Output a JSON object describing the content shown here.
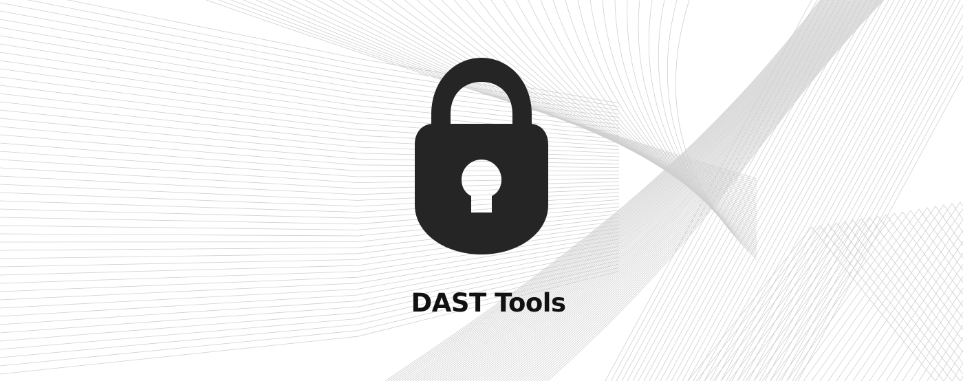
{
  "banner": {
    "title": "DAST Tools",
    "icon": "padlock-icon",
    "icon_color": "#252525",
    "line_color": "#cfcfcf",
    "background_color": "#ffffff"
  }
}
